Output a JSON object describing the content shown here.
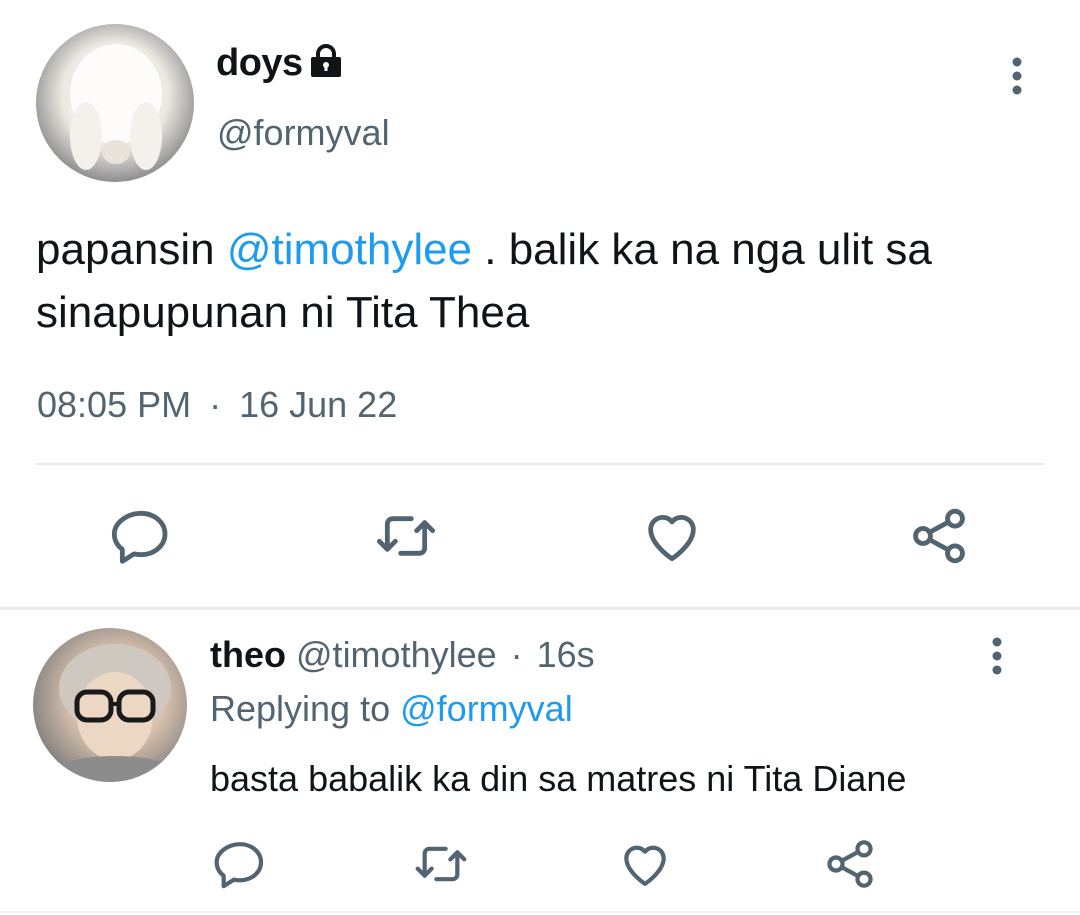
{
  "tweet": {
    "author_name": "doys",
    "author_handle": "@formyval",
    "text_before": "papansin ",
    "text_mention": "@timothylee",
    "text_after": " . balik ka na nga ulit sa sinapupunan ni Tita Thea",
    "time": "08:05 PM",
    "separator": "·",
    "date": "16 Jun 22",
    "icons": [
      "lock-icon",
      "more-vertical-icon",
      "reply-icon",
      "retweet-icon",
      "like-icon",
      "share-icon"
    ]
  },
  "reply": {
    "author_name": "theo",
    "author_handle": "@timothylee",
    "separator": "·",
    "time": "16s",
    "replying_prefix": "Replying to",
    "replying_handle": "@formyval",
    "text": "basta babalik ka din sa matres ni Tita Diane",
    "icons": [
      "more-vertical-icon",
      "reply-icon",
      "retweet-icon",
      "like-icon",
      "share-icon"
    ]
  },
  "colors": {
    "link": "#1d9bf0",
    "secondary_text": "#536471",
    "icon": "#536471",
    "divider": "#e8ecee"
  }
}
